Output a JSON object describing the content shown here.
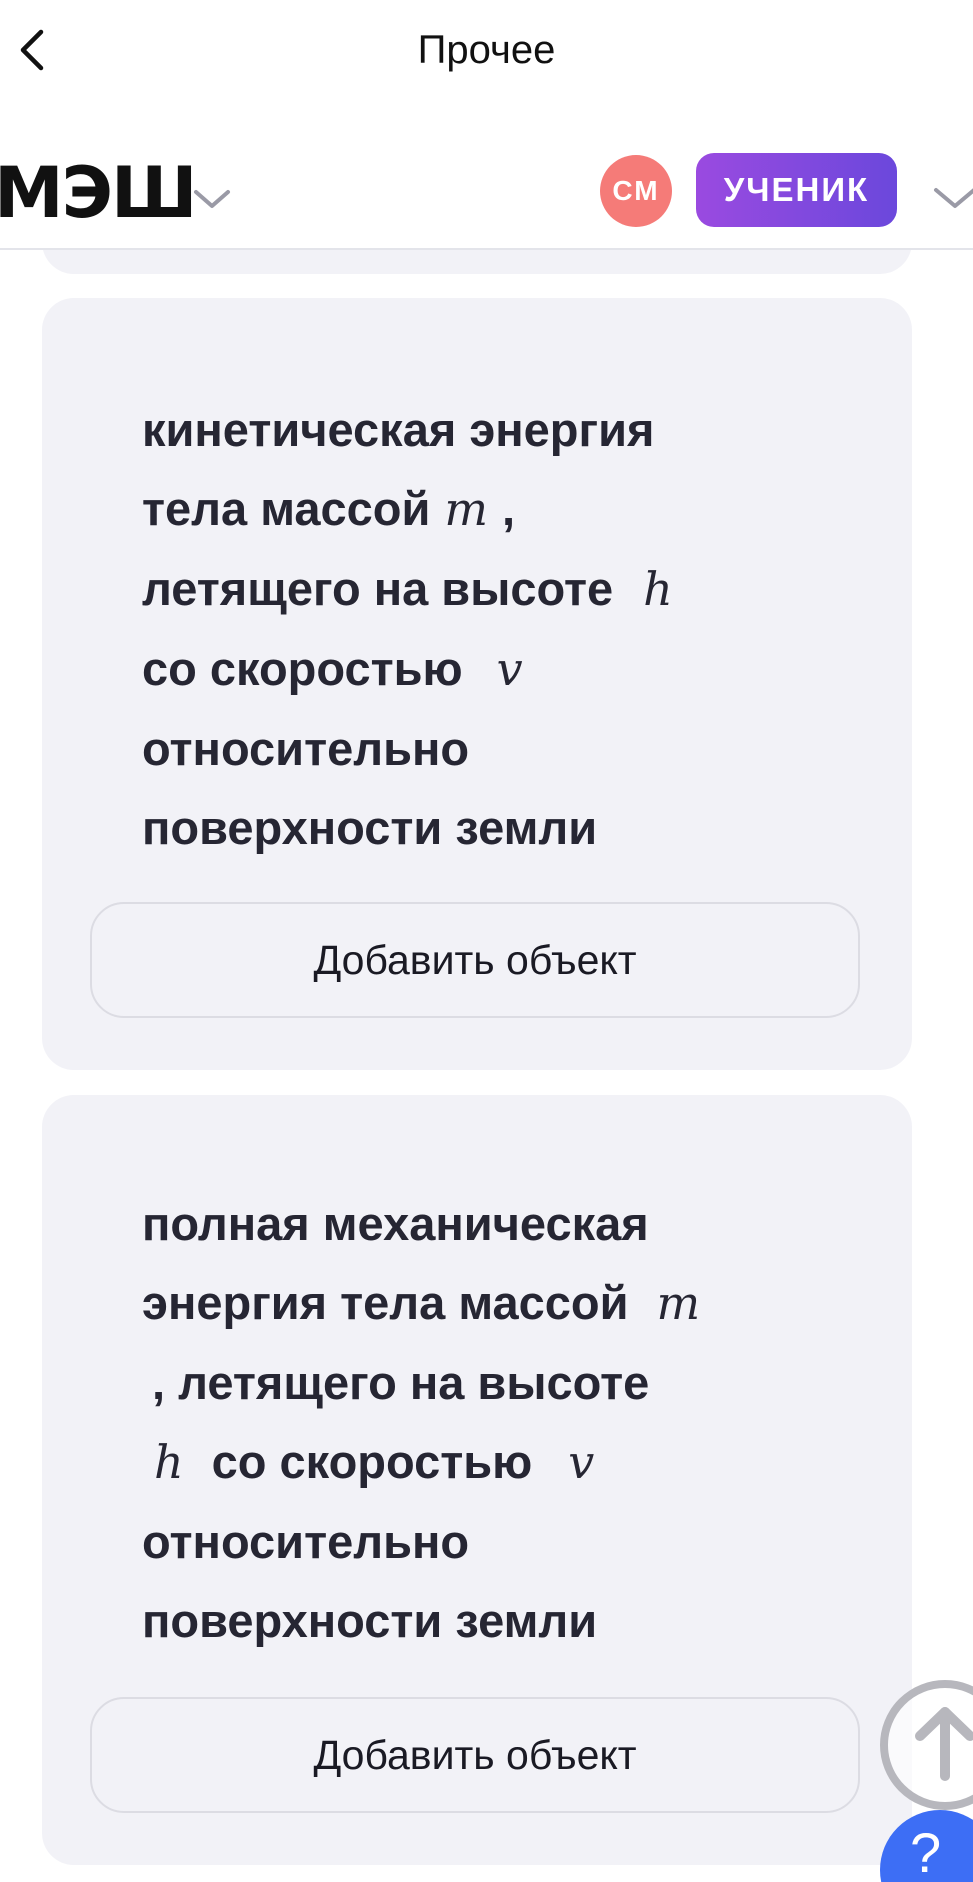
{
  "navbar": {
    "title": "Прочее",
    "back_icon": "chevron-left-icon"
  },
  "header": {
    "logo_text": "МЭШ",
    "avatar_initials": "СМ",
    "role_label": "УЧЕНИК",
    "colors": {
      "avatar_bg": "#f57b78",
      "role_gradient_start": "#9a4ae0",
      "role_gradient_end": "#6b48dc"
    }
  },
  "cards": [
    {
      "lines": [
        {
          "text": "кинетическая энергия",
          "math_after": ""
        },
        {
          "text": "тела массой",
          "math_after": "m",
          "tail": ","
        },
        {
          "text": "летящего на высоте",
          "math_after": "h"
        },
        {
          "text": "со скоростью",
          "math_after": "v"
        },
        {
          "text": "относительно",
          "math_after": ""
        },
        {
          "text": "поверхности земли",
          "math_after": ""
        }
      ],
      "button_label": "Добавить объект"
    },
    {
      "lines": [
        {
          "text": "полная механическая",
          "math_after": ""
        },
        {
          "text": "энергия тела массой",
          "math_after": "m"
        },
        {
          "text": ", летящего на высоте",
          "math_after": ""
        },
        {
          "math_before": "h",
          "text": "со скоростью",
          "math_after": "v"
        },
        {
          "text": "относительно",
          "math_after": ""
        },
        {
          "text": "поверхности земли",
          "math_after": ""
        }
      ],
      "button_label": "Добавить объект"
    }
  ],
  "floating": {
    "scroll_top_icon": "arrow-up-icon",
    "help_label": "?",
    "help_color": "#3d6ef5"
  }
}
